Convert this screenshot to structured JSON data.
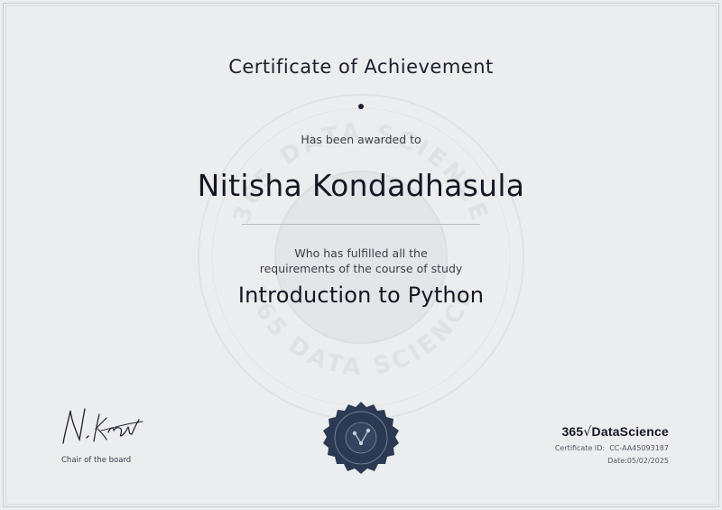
{
  "certificate": {
    "title": "Certificate of Achievement",
    "awarded_text": "Has been awarded to",
    "recipient_name": "Nitisha Kondadhasula",
    "fulfilled_line1": "Who has fulfilled all the",
    "fulfilled_line2": "requirements of the course of study",
    "course_name": "Introduction to Python"
  },
  "signatory": {
    "signature_text": "N.Krastev",
    "role": "Chair of the board"
  },
  "brand": {
    "name_prefix": "365",
    "name_symbol": "√",
    "name_suffix": "DataScience",
    "watermark_text": "365 DATA SCIENCE"
  },
  "details": {
    "certificate_id_label": "Certificate ID:",
    "certificate_id": "CC-AA45093187",
    "date_label": "Date:",
    "date": "05/02/2025"
  },
  "colors": {
    "background": "#ebedee",
    "text_dark": "#141824",
    "seal": "#2b3a52"
  }
}
